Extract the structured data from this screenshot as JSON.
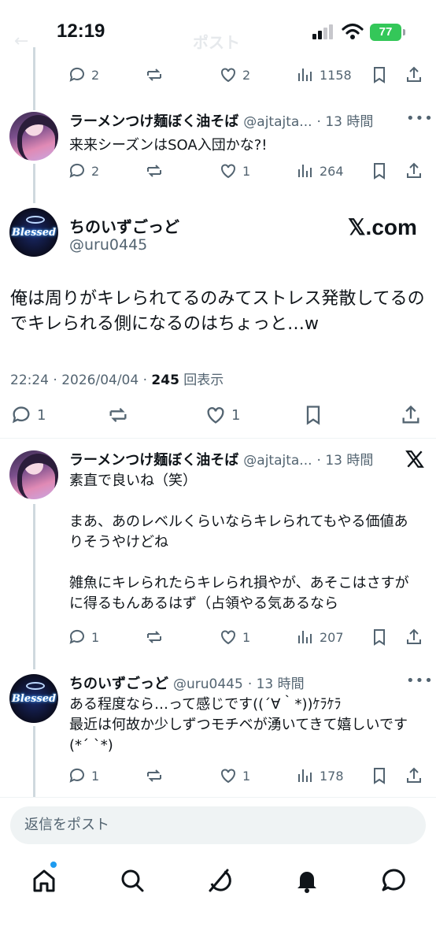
{
  "status": {
    "time": "12:19",
    "battery": "77"
  },
  "ghost_header": {
    "back": "←",
    "title": "ポスト"
  },
  "top_partial_actions": {
    "reply": "2",
    "repost": "",
    "like": "2",
    "views": "1158"
  },
  "tweet1": {
    "name": "ラーメンつけ麺ぼく油そば",
    "handle": "@ajtajta...",
    "time": "· 13 時間",
    "text": "来来シーズンはSOA入団かな?!",
    "reply": "2",
    "like": "1",
    "views": "264"
  },
  "main": {
    "name": "ちのいずごっど",
    "handle": "@uru0445",
    "brand": "𝕏.com",
    "avatar_text": "Blessed",
    "text": "俺は周りがキレられてるのみてストレス発散してるのでキレられる側になるのはちょっと…w",
    "meta_prefix": "22:24 · 2026/04/04 · ",
    "views": "245",
    "views_suffix": " 回表示",
    "reply": "1",
    "like": "1"
  },
  "tweet2": {
    "name": "ラーメンつけ麺ぼく油そば",
    "handle": "@ajtajta...",
    "time": "· 13 時間",
    "text": "素直で良いね（笑）\n\nまあ、あのレベルくらいならキレられてもやる価値ありそうやけどね\n\n雑魚にキレられたらキレられ損やが、あそこはさすがに得るもんあるはず（占領やる気あるなら",
    "reply": "1",
    "like": "1",
    "views": "207"
  },
  "tweet3": {
    "name": "ちのいずごっど",
    "handle": "@uru0445",
    "time": "· 13 時間",
    "avatar_text": "Blessed",
    "text": "ある程度なら…って感じです((´∀｀*))ｹﾗｹﾗ\n最近は何故か少しずつモチベが湧いてきて嬉しいです(*´ `*)",
    "reply": "1",
    "like": "1",
    "views": "178"
  },
  "more_glyph": "•••",
  "reply_placeholder": "返信をポスト",
  "icons": [
    "reply-icon",
    "repost-icon",
    "like-icon",
    "views-icon",
    "bookmark-icon",
    "share-icon",
    "home-icon",
    "search-icon",
    "grok-icon",
    "notifications-icon",
    "messages-icon"
  ],
  "colors": {
    "text": "#0f1419",
    "muted": "#536471",
    "thread_line": "#cfd9de",
    "accent": "#1d9bf0",
    "battery": "#34c759"
  }
}
